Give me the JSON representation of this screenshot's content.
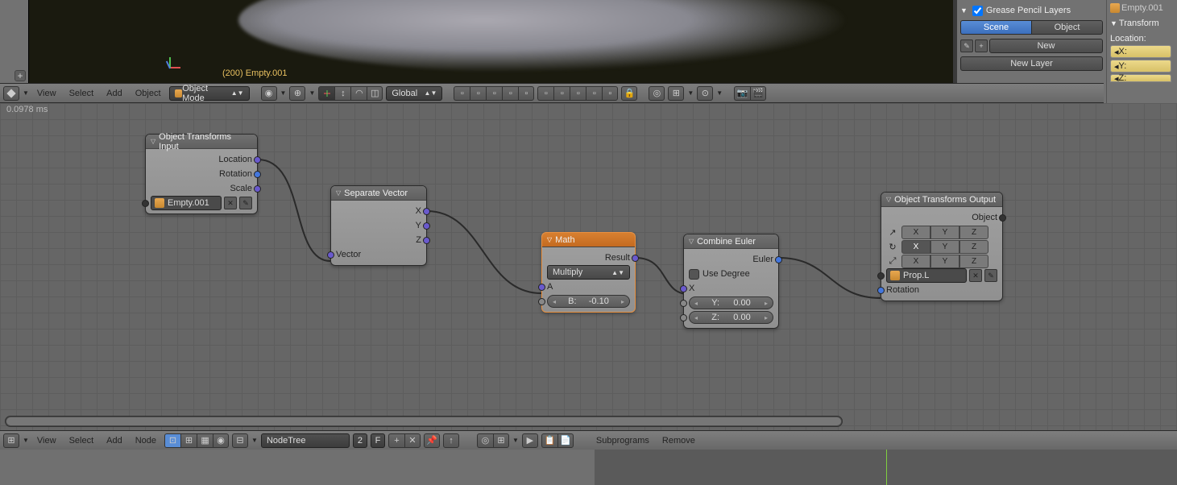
{
  "viewport": {
    "label": "(200) Empty.001"
  },
  "toolbar": {
    "menus": [
      "View",
      "Select",
      "Add",
      "Object"
    ],
    "mode": "Object Mode",
    "orientation": "Global"
  },
  "panel_grease": {
    "title": "Grease Pencil Layers"
  },
  "panel_tabs": {
    "scene": "Scene",
    "object": "Object"
  },
  "panel_new": "New",
  "panel_new_layer": "New Layer",
  "panel_right2": {
    "breadcrumb": "Empty.001",
    "transform": "Transform",
    "location": "Location:",
    "x": "X:",
    "y": "Y:",
    "z": "Z:"
  },
  "timing": "0.0978 ms",
  "nodes": {
    "input": {
      "title": "Object Transforms Input",
      "location": "Location",
      "rotation": "Rotation",
      "scale": "Scale",
      "object": "Empty.001"
    },
    "separate": {
      "title": "Separate Vector",
      "x": "X",
      "y": "Y",
      "z": "Z",
      "vector": "Vector"
    },
    "math": {
      "title": "Math",
      "result": "Result",
      "op": "Multiply",
      "a": "A",
      "b_label": "B:",
      "b_val": "-0.10"
    },
    "combine": {
      "title": "Combine Euler",
      "euler": "Euler",
      "degree": "Use Degree",
      "x": "X",
      "y_label": "Y:",
      "y_val": "0.00",
      "z_label": "Z:",
      "z_val": "0.00"
    },
    "output": {
      "title": "Object Transforms Output",
      "object_label": "Object",
      "X": "X",
      "Y": "Y",
      "Z": "Z",
      "target": "Prop.L",
      "rotation": "Rotation"
    }
  },
  "bottom": {
    "menus": [
      "View",
      "Select",
      "Add",
      "Node"
    ],
    "tree": "NodeTree",
    "count": "2",
    "fake": "F",
    "subprograms": "Subprograms",
    "remove": "Remove"
  }
}
